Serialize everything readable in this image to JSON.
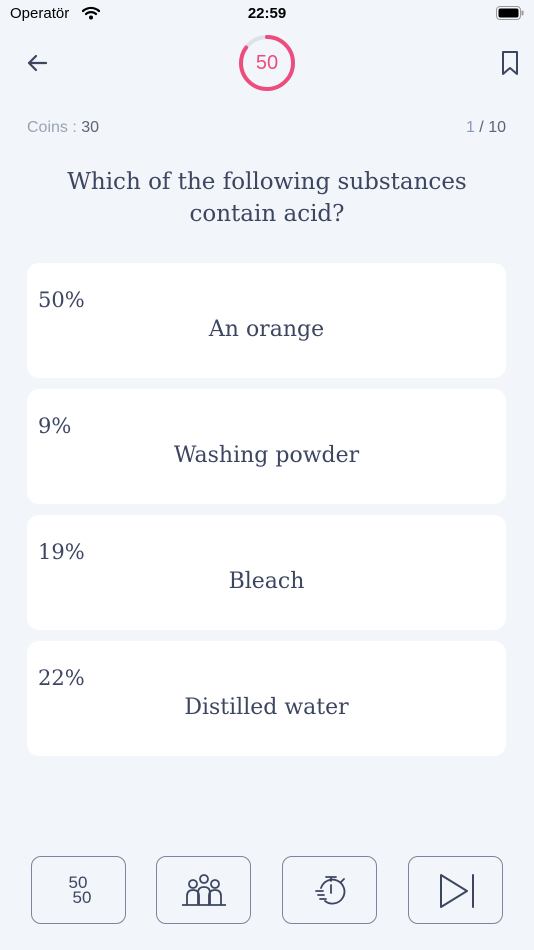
{
  "status_bar": {
    "carrier": "Operatör",
    "time": "22:59"
  },
  "header": {
    "timer_value": "50",
    "timer_remaining_fraction": 0.85
  },
  "stats": {
    "coins_label": "Coins : ",
    "coins_value": "30",
    "progress_current": "1",
    "progress_total": " / 10"
  },
  "question": {
    "text": "Which of the following substances contain acid?"
  },
  "answers": [
    {
      "percent": "50%",
      "text": "An orange"
    },
    {
      "percent": "9%",
      "text": "Washing powder"
    },
    {
      "percent": "19%",
      "text": "Bleach"
    },
    {
      "percent": "22%",
      "text": "Distilled water"
    }
  ],
  "jokers": [
    {
      "icon": "fifty-fifty-icon",
      "top": "50",
      "bottom": "50"
    },
    {
      "icon": "audience-icon"
    },
    {
      "icon": "stopwatch-icon"
    },
    {
      "icon": "skip-icon"
    }
  ],
  "colors": {
    "accent": "#ec4d7d",
    "text": "#3d4660",
    "background": "#f2f5fa"
  }
}
